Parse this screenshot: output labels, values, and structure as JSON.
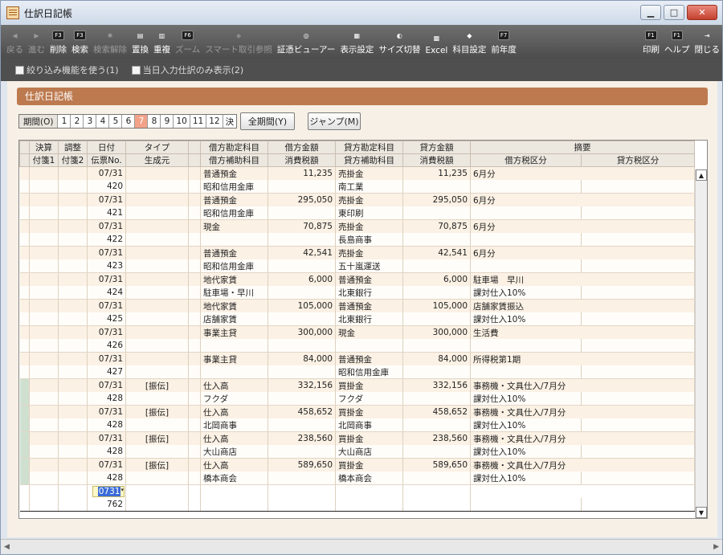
{
  "window": {
    "title": "仕訳日記帳",
    "minimize": "▁",
    "maximize": "□",
    "close": "✕"
  },
  "toolbar": {
    "buttons": [
      {
        "label": "戻る",
        "key": "",
        "icon": "back-arrow-icon",
        "enabled": false
      },
      {
        "label": "進む",
        "key": "",
        "icon": "forward-arrow-icon",
        "enabled": false
      },
      {
        "label": "削除",
        "key": "F3",
        "icon": "delete-icon",
        "enabled": true
      },
      {
        "label": "検索",
        "key": "F3",
        "icon": "search-icon",
        "enabled": true
      },
      {
        "label": "検索解除",
        "key": "",
        "icon": "clear-search-icon",
        "enabled": false
      },
      {
        "label": "置換",
        "key": "",
        "icon": "replace-icon",
        "enabled": true
      },
      {
        "label": "重複",
        "key": "",
        "icon": "duplicate-icon",
        "enabled": true
      },
      {
        "label": "ズーム",
        "key": "F6",
        "icon": "zoom-icon",
        "enabled": false
      },
      {
        "label": "スマート取引参照",
        "key": "",
        "icon": "smart-trade-icon",
        "enabled": false
      },
      {
        "label": "証憑ビューアー",
        "key": "",
        "icon": "voucher-viewer-icon",
        "enabled": true
      },
      {
        "label": "表示設定",
        "key": "",
        "icon": "display-settings-icon",
        "enabled": true
      },
      {
        "label": "サイズ切替",
        "key": "",
        "icon": "size-toggle-icon",
        "enabled": true
      },
      {
        "label": "Excel",
        "key": "",
        "icon": "excel-icon",
        "enabled": true
      },
      {
        "label": "科目設定",
        "key": "",
        "icon": "account-settings-icon",
        "enabled": true
      },
      {
        "label": "前年度",
        "key": "F7",
        "icon": "previous-year-icon",
        "enabled": true
      }
    ],
    "right_buttons": [
      {
        "label": "印刷",
        "key": "F1",
        "icon": "print-icon"
      },
      {
        "label": "ヘルプ",
        "key": "F1",
        "icon": "help-icon"
      },
      {
        "label": "閉じる",
        "key": "",
        "icon": "exit-icon"
      }
    ]
  },
  "filters": {
    "filter_label": "絞り込み機能を使う(1)",
    "today_label": "当日入力仕訳のみ表示(2)"
  },
  "section_title": "仕訳日記帳",
  "period": {
    "label": "期間(O)",
    "months": [
      "1",
      "2",
      "3",
      "4",
      "5",
      "6",
      "7",
      "8",
      "9",
      "10",
      "11",
      "12",
      "決"
    ],
    "active": "7"
  },
  "buttons": {
    "all_period": "全期間(Y)",
    "jump": "ジャンプ(M)"
  },
  "grid": {
    "header1": [
      "決算",
      "調整",
      "日付",
      "タイプ",
      "",
      "借方勘定科目",
      "借方金額",
      "貸方勘定科目",
      "貸方金額",
      "摘要"
    ],
    "header2": [
      "付箋1",
      "付箋2",
      "伝票No.",
      "生成元",
      "",
      "借方補助科目",
      "消費税額",
      "貸方補助科目",
      "消費税額",
      "借方税区分",
      "貸方税区分"
    ],
    "entries": [
      {
        "date": "07/31",
        "no": "420",
        "type": "",
        "dr": "普通預金",
        "dr_sub": "昭和信用金庫",
        "dr_amt": "11,235",
        "cr": "売掛金",
        "cr_sub": "南工業",
        "cr_amt": "11,235",
        "memo": "6月分",
        "tax": "",
        "green": false
      },
      {
        "date": "07/31",
        "no": "421",
        "type": "",
        "dr": "普通預金",
        "dr_sub": "昭和信用金庫",
        "dr_amt": "295,050",
        "cr": "売掛金",
        "cr_sub": "東印刷",
        "cr_amt": "295,050",
        "memo": "6月分",
        "tax": "",
        "green": false
      },
      {
        "date": "07/31",
        "no": "422",
        "type": "",
        "dr": "現金",
        "dr_sub": "",
        "dr_amt": "70,875",
        "cr": "売掛金",
        "cr_sub": "長島商事",
        "cr_amt": "70,875",
        "memo": "6月分",
        "tax": "",
        "green": false
      },
      {
        "date": "07/31",
        "no": "423",
        "type": "",
        "dr": "普通預金",
        "dr_sub": "昭和信用金庫",
        "dr_amt": "42,541",
        "cr": "売掛金",
        "cr_sub": "五十嵐運送",
        "cr_amt": "42,541",
        "memo": "6月分",
        "tax": "",
        "green": false
      },
      {
        "date": "07/31",
        "no": "424",
        "type": "",
        "dr": "地代家賃",
        "dr_sub": "駐車場・早川",
        "dr_amt": "6,000",
        "cr": "普通預金",
        "cr_sub": "北東銀行",
        "cr_amt": "6,000",
        "memo": "駐車場　早川",
        "tax": "課対仕入10%",
        "green": false
      },
      {
        "date": "07/31",
        "no": "425",
        "type": "",
        "dr": "地代家賃",
        "dr_sub": "店舗家賃",
        "dr_amt": "105,000",
        "cr": "普通預金",
        "cr_sub": "北東銀行",
        "cr_amt": "105,000",
        "memo": "店舗家賃振込",
        "tax": "課対仕入10%",
        "green": false
      },
      {
        "date": "07/31",
        "no": "426",
        "type": "",
        "dr": "事業主貸",
        "dr_sub": "",
        "dr_amt": "300,000",
        "cr": "現金",
        "cr_sub": "",
        "cr_amt": "300,000",
        "memo": "生活費",
        "tax": "",
        "green": false
      },
      {
        "date": "07/31",
        "no": "427",
        "type": "",
        "dr": "事業主貸",
        "dr_sub": "",
        "dr_amt": "84,000",
        "cr": "普通預金",
        "cr_sub": "昭和信用金庫",
        "cr_amt": "84,000",
        "memo": "所得税第1期",
        "tax": "",
        "green": false
      },
      {
        "date": "07/31",
        "no": "428",
        "type": "[振伝]",
        "dr": "仕入高",
        "dr_sub": "フクダ",
        "dr_amt": "332,156",
        "cr": "買掛金",
        "cr_sub": "フクダ",
        "cr_amt": "332,156",
        "memo": "事務機・文具仕入/7月分",
        "tax": "課対仕入10%",
        "green": true
      },
      {
        "date": "07/31",
        "no": "428",
        "type": "[振伝]",
        "dr": "仕入高",
        "dr_sub": "北岡商事",
        "dr_amt": "458,652",
        "cr": "買掛金",
        "cr_sub": "北岡商事",
        "cr_amt": "458,652",
        "memo": "事務機・文具仕入/7月分",
        "tax": "課対仕入10%",
        "green": true
      },
      {
        "date": "07/31",
        "no": "428",
        "type": "[振伝]",
        "dr": "仕入高",
        "dr_sub": "大山商店",
        "dr_amt": "238,560",
        "cr": "買掛金",
        "cr_sub": "大山商店",
        "cr_amt": "238,560",
        "memo": "事務機・文具仕入/7月分",
        "tax": "課対仕入10%",
        "green": true
      },
      {
        "date": "07/31",
        "no": "428",
        "type": "[振伝]",
        "dr": "仕入高",
        "dr_sub": "橋本商会",
        "dr_amt": "589,650",
        "cr": "買掛金",
        "cr_sub": "橋本商会",
        "cr_amt": "589,650",
        "memo": "事務機・文具仕入/7月分",
        "tax": "課対仕入10%",
        "green": true
      }
    ],
    "new_entry": {
      "date": "0731",
      "no": "762"
    }
  },
  "scroll": {
    "left": "◀",
    "right": "▶",
    "up": "▲",
    "down": "▼"
  }
}
